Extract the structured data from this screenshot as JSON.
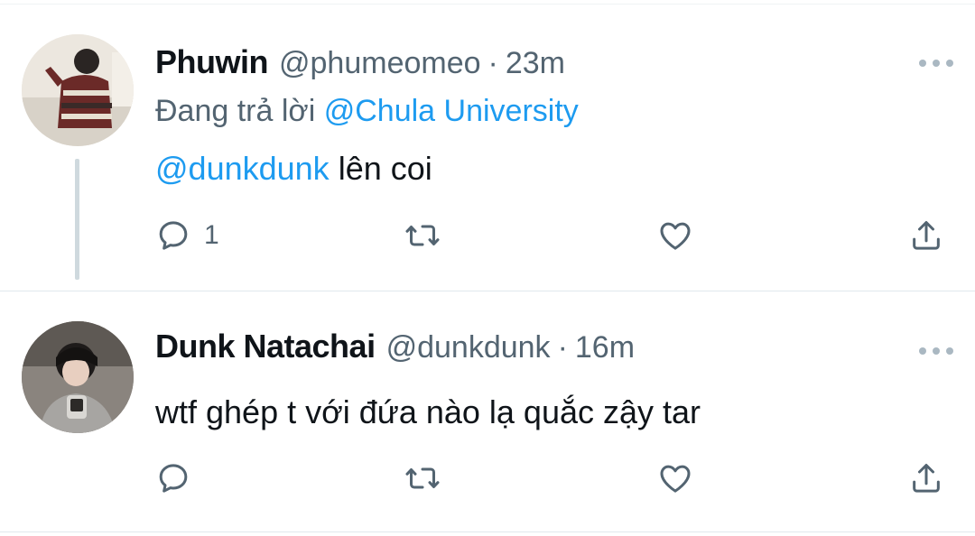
{
  "colors": {
    "link": "#1d9bf0",
    "secondary_text": "#536471",
    "primary_text": "#0f1419",
    "icon": "#536471",
    "thread_line": "#cfd9de"
  },
  "tweets": [
    {
      "name": "Phuwin",
      "handle": "@phumeomeo",
      "separator": "·",
      "time": "23m",
      "reply_prefix": "Đang trả lời",
      "reply_target": "@Chula University",
      "mention": "@dunkdunk",
      "text": " lên coi",
      "reply_count": "1",
      "icons": [
        "reply-icon",
        "retweet-icon",
        "like-icon",
        "share-icon",
        "more-icon"
      ]
    },
    {
      "name": "Dunk Natachai",
      "handle": "@dunkdunk",
      "separator": "·",
      "time": "16m",
      "text": "wtf ghép t với đứa nào lạ quắc zậy tar",
      "icons": [
        "reply-icon",
        "retweet-icon",
        "like-icon",
        "share-icon",
        "more-icon"
      ]
    }
  ]
}
